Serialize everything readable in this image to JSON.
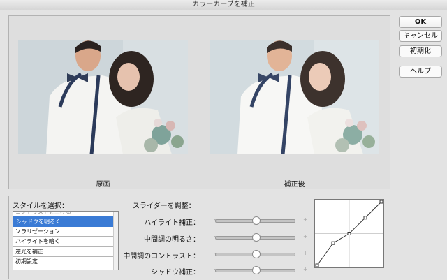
{
  "window": {
    "title": "カラーカーブを補正"
  },
  "preview": {
    "original_label": "原画",
    "corrected_label": "補正後"
  },
  "buttons": {
    "ok": "OK",
    "cancel": "キャンセル",
    "reset": "初期化",
    "help": "ヘルプ"
  },
  "style": {
    "label": "スタイルを選択：",
    "items": [
      {
        "label": "コントラストを上げる",
        "selected": false
      },
      {
        "label": "シャドウを明るく",
        "selected": true
      },
      {
        "label": "ソラリゼーション",
        "selected": false
      },
      {
        "label": "ハイライトを暗く",
        "selected": false
      },
      {
        "label": "逆光を補正",
        "selected": false
      },
      {
        "label": "初期設定",
        "selected": false
      }
    ]
  },
  "sliders": {
    "label": "スライダーを調整：",
    "items": [
      {
        "label": "ハイライト補正：",
        "minus": "-",
        "plus": "+",
        "value": 0.5
      },
      {
        "label": "中間調の明るさ：",
        "minus": "-",
        "plus": "+",
        "value": 0.5
      },
      {
        "label": "中間調のコントラスト：",
        "minus": "-",
        "plus": "+",
        "value": 0.5
      },
      {
        "label": "シャドウ補正：",
        "minus": "-",
        "plus": "+",
        "value": 0.5
      }
    ]
  },
  "curve": {
    "points": [
      [
        0,
        0
      ],
      [
        0.25,
        0.35
      ],
      [
        0.5,
        0.5
      ],
      [
        0.75,
        0.75
      ],
      [
        1,
        1
      ]
    ]
  }
}
